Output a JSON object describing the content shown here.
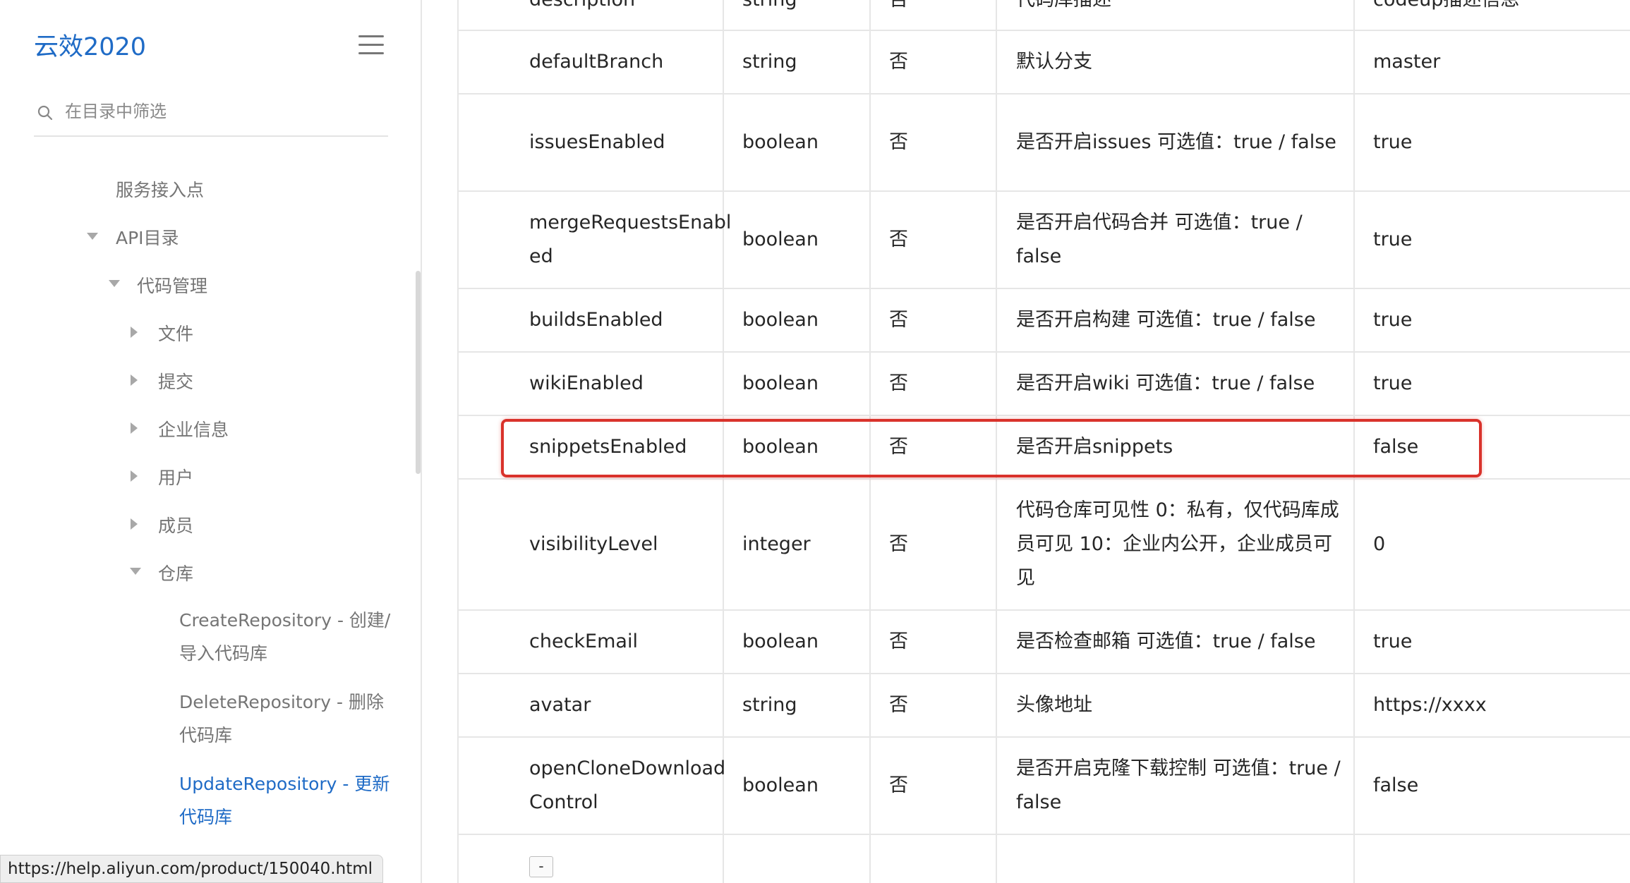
{
  "sidebar": {
    "brand": "云效2020",
    "search_placeholder": "在目录中筛选",
    "items": [
      {
        "label": "服务接入点"
      },
      {
        "label": "API目录"
      },
      {
        "label": "代码管理"
      },
      {
        "label": "文件"
      },
      {
        "label": "提交"
      },
      {
        "label": "企业信息"
      },
      {
        "label": "用户"
      },
      {
        "label": "成员"
      },
      {
        "label": "仓库"
      },
      {
        "label": "CreateRepository - 创建/导入代码库"
      },
      {
        "label": "DeleteRepository - 删除代码库"
      },
      {
        "label": "UpdateRepository - 更新代码库"
      }
    ],
    "status_url": "https://help.aliyun.com/product/150040.html"
  },
  "table": {
    "top_partial": [
      "description",
      "string",
      "否",
      "代码库描述",
      "codeup描述信息"
    ],
    "rows": [
      {
        "name": "defaultBranch",
        "type": "string",
        "required": "否",
        "desc": "默认分支",
        "example": "master"
      },
      {
        "name": "issuesEnabled",
        "type": "boolean",
        "required": "否",
        "desc": "是否开启issues 可选值：true / false",
        "example": "true"
      },
      {
        "name": "mergeRequestsEnabled",
        "type": "boolean",
        "required": "否",
        "desc": "是否开启代码合并 可选值：true / false",
        "example": "true"
      },
      {
        "name": "buildsEnabled",
        "type": "boolean",
        "required": "否",
        "desc": "是否开启构建 可选值：true / false",
        "example": "true"
      },
      {
        "name": "wikiEnabled",
        "type": "boolean",
        "required": "否",
        "desc": "是否开启wiki 可选值：true / false",
        "example": "true"
      },
      {
        "name": "snippetsEnabled",
        "type": "boolean",
        "required": "否",
        "desc": "是否开启snippets",
        "example": "false"
      },
      {
        "name": "visibilityLevel",
        "type": "integer",
        "required": "否",
        "desc": "代码仓库可见性 0：私有，仅代码库成员可见 10：企业内公开，企业成员可见",
        "example": "0"
      },
      {
        "name": "checkEmail",
        "type": "boolean",
        "required": "否",
        "desc": "是否检查邮箱 可选值：true / false",
        "example": "true"
      },
      {
        "name": "avatar",
        "type": "string",
        "required": "否",
        "desc": "头像地址",
        "example": "https://xxxx"
      },
      {
        "name": "openCloneDownloadControl",
        "type": "boolean",
        "required": "否",
        "desc": "是否开启克隆下载控制 可选值：true / false",
        "example": "false"
      }
    ],
    "expander_label": "-"
  },
  "colors": {
    "accent": "#1f6bc6",
    "highlight": "#d9322b"
  }
}
